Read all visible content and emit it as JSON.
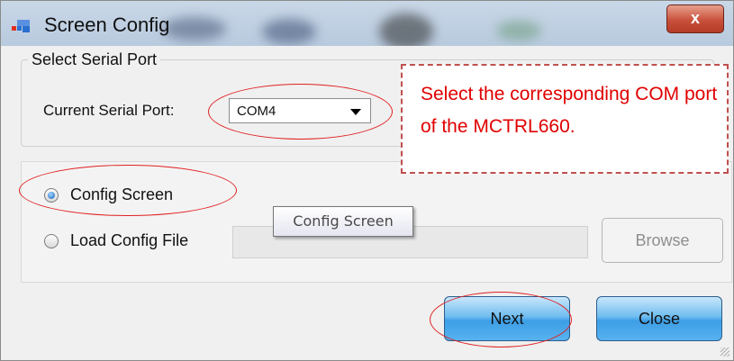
{
  "window": {
    "title": "Screen Config",
    "close_symbol": "x"
  },
  "serial_group": {
    "legend": "Select Serial Port",
    "port_label": "Current Serial Port:",
    "port_value": "COM4"
  },
  "options": {
    "config_screen_label": "Config Screen",
    "load_config_label": "Load Config File",
    "file_path_value": "",
    "browse_label": "Browse",
    "selected": "config_screen"
  },
  "tooltip": {
    "text": "Config Screen"
  },
  "buttons": {
    "next_label": "Next",
    "close_label": "Close"
  },
  "annotation": {
    "text": "Select the corresponding COM port of the MCTRL660."
  },
  "icons": {
    "window_icon": "window-app-icon",
    "dropdown_arrow": "chevron-down-icon"
  },
  "colors": {
    "annotation_red": "#e00000",
    "button_blue": "#3d9ee6",
    "close_red": "#c9513b"
  }
}
